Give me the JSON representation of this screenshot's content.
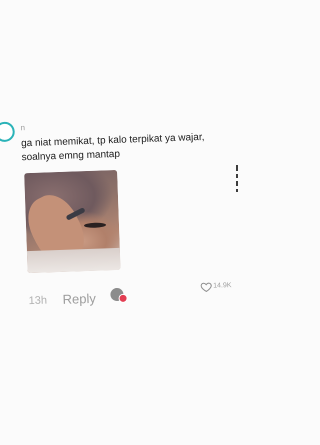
{
  "comment": {
    "username": "n",
    "text": "ga niat memikat, tp kalo terpikat ya wajar, soalnya emng mantap",
    "time": "13h",
    "reply_label": "Reply",
    "like_count": "14.9K"
  },
  "colors": {
    "avatar_ring": "#2ab3b8",
    "reply_badge": "#e23d52"
  },
  "icons": {
    "like": "heart-outline-icon"
  }
}
